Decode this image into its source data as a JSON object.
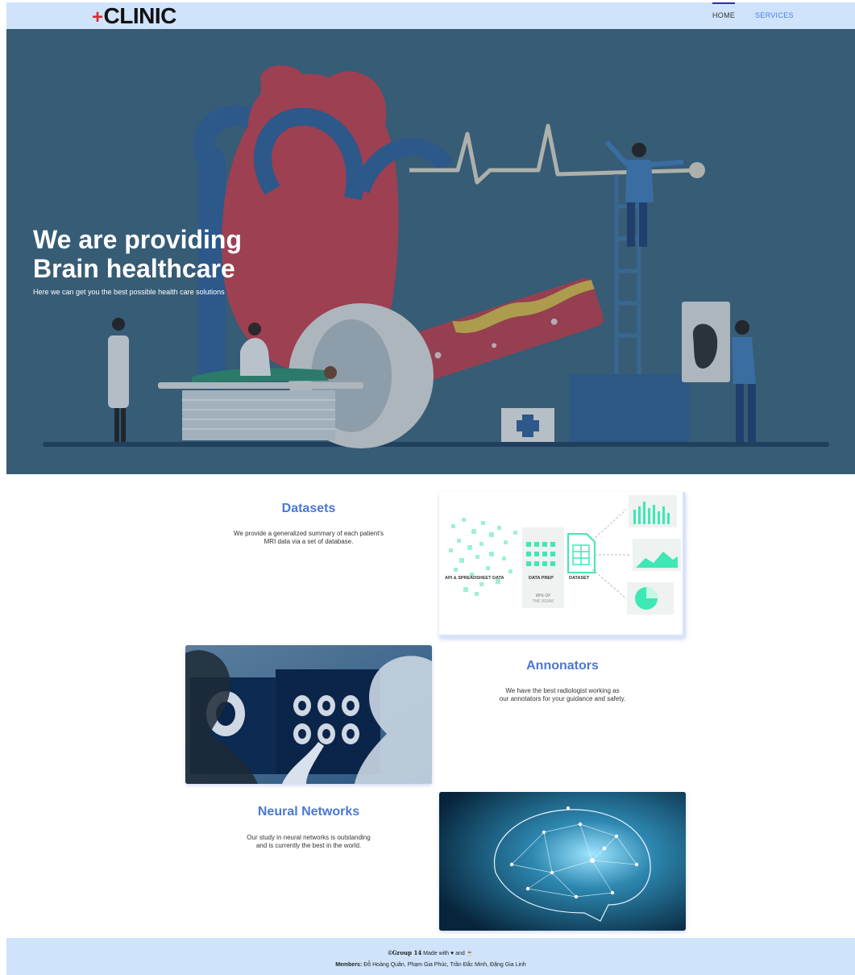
{
  "nav": {
    "logo_plus": "+",
    "logo_text": "CLINIC",
    "items": [
      {
        "label": "HOME"
      },
      {
        "label": "SERVICES"
      }
    ]
  },
  "hero": {
    "title_line1": "We are providing",
    "title_line2": "Brain healthcare",
    "subtitle": "Here we can get you the best possible health care solutions"
  },
  "features": {
    "datasets": {
      "title": "Datasets",
      "text_line1": "We provide a generalized summary of each patient's",
      "text_line2": "MRI data via a set of database.",
      "diagram": {
        "label_api": "API & SPREADSHEET DATA",
        "label_prep": "DATA PREP",
        "label_dataset": "DATASET",
        "note_line1": "80% OF",
        "note_line2": "THE WORK"
      }
    },
    "annotators": {
      "title": "Annonators",
      "text_line1": "We have the best radiologist working as",
      "text_line2": "our annotators for your guidance and safety."
    },
    "neural": {
      "title": "Neural Networks",
      "text_line1": "Our study in neural networks is outstanding",
      "text_line2": "and is currently the best in the world."
    }
  },
  "footer": {
    "copyright_symbol": "©",
    "group": "Group 14",
    "made_with": "Made with",
    "and": "and",
    "members_label": "Members:",
    "members": "Đỗ Hoàng Quân, Phạm Gia Phúc, Trần Đắc Minh, Đặng Gia Linh"
  },
  "colors": {
    "nav_bg": "#cfe3fb",
    "hero_bg": "#3b6079",
    "accent_blue": "#4a78d4",
    "logo_red": "#d32f2f",
    "teal": "#3ee8b5"
  }
}
